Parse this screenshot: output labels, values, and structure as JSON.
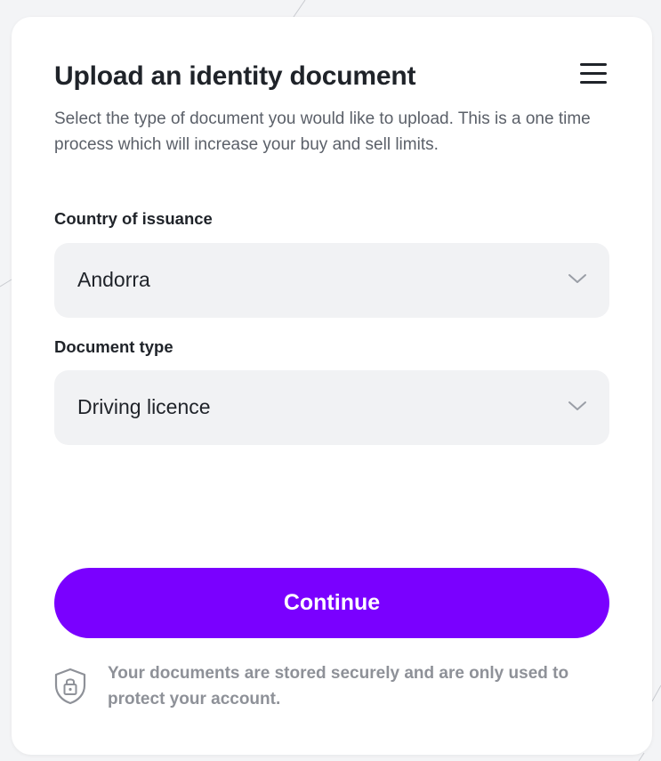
{
  "header": {
    "title": "Upload an identity document",
    "subtitle": "Select the type of document you would like to upload. This is a one time process which will increase your buy and sell limits.",
    "menu_icon": "hamburger-menu-icon"
  },
  "form": {
    "country": {
      "label": "Country of issuance",
      "value": "Andorra"
    },
    "document_type": {
      "label": "Document type",
      "value": "Driving licence"
    },
    "dropdown_icon": "chevron-down-icon"
  },
  "actions": {
    "continue_label": "Continue"
  },
  "security_note": {
    "icon": "shield-lock-icon",
    "text": "Your documents are stored securely and are only used to protect your account."
  },
  "colors": {
    "accent": "#7a00ff",
    "background": "#f3f4f6",
    "card": "#ffffff",
    "field_background": "#f1f2f4",
    "text_primary": "#1f2329",
    "text_secondary": "#5b6069",
    "text_muted": "#8e9198"
  }
}
